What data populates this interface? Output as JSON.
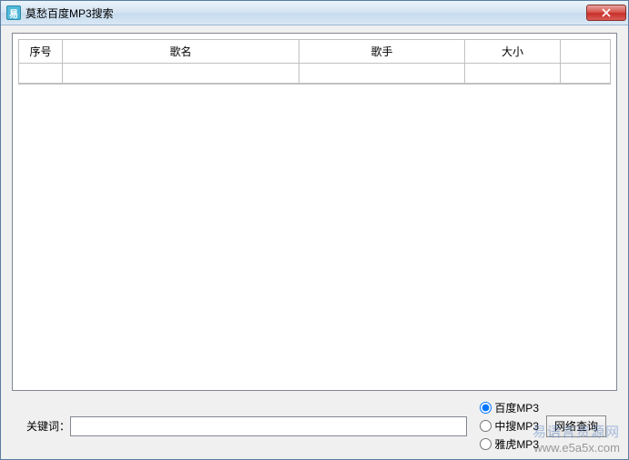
{
  "window": {
    "title": "莫愁百度MP3搜索"
  },
  "table": {
    "columns": {
      "seq": "序号",
      "name": "歌名",
      "artist": "歌手",
      "size": "大小"
    }
  },
  "footer": {
    "keyword_label": "关键词：",
    "keyword_value": "",
    "radios": {
      "baidu": "百度MP3",
      "zhongsou": "中搜MP3",
      "yahoo": "雅虎MP3"
    },
    "query_button": "网络查询"
  },
  "watermark": {
    "line1": "易语言资源网",
    "line2": "www.e5a5x.com"
  }
}
